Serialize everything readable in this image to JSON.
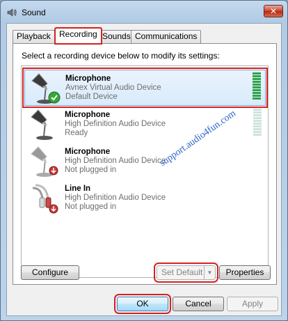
{
  "window": {
    "title": "Sound",
    "close_label": "✕"
  },
  "tabs": [
    {
      "label": "Playback"
    },
    {
      "label": "Recording"
    },
    {
      "label": "Sounds"
    },
    {
      "label": "Communications"
    }
  ],
  "instructions": "Select a recording device below to modify its settings:",
  "devices": [
    {
      "name": "Microphone",
      "driver": "Avnex Virtual Audio Device",
      "status": "Default Device",
      "icon": "microphone-icon",
      "badge": "default-check-icon",
      "level_bars": 10,
      "selected": true
    },
    {
      "name": "Microphone",
      "driver": "High Definition Audio Device",
      "status": "Ready",
      "icon": "microphone-icon",
      "badge": "",
      "level_bars": 0,
      "selected": false
    },
    {
      "name": "Microphone",
      "driver": "High Definition Audio Device",
      "status": "Not plugged in",
      "icon": "microphone-icon",
      "badge": "unplugged-icon",
      "selected": false
    },
    {
      "name": "Line In",
      "driver": "High Definition Audio Device",
      "status": "Not plugged in",
      "icon": "line-in-cable-icon",
      "badge": "unplugged-icon",
      "selected": false
    }
  ],
  "watermark": "support.audio4fun.com",
  "buttons": {
    "configure": "Configure",
    "set_default": "Set Default",
    "properties": "Properties",
    "ok": "OK",
    "cancel": "Cancel",
    "apply": "Apply"
  },
  "colors": {
    "highlight_outline": "#d32121",
    "meter_active": "#2ea44a",
    "meter_idle": "#cfe3dd"
  }
}
